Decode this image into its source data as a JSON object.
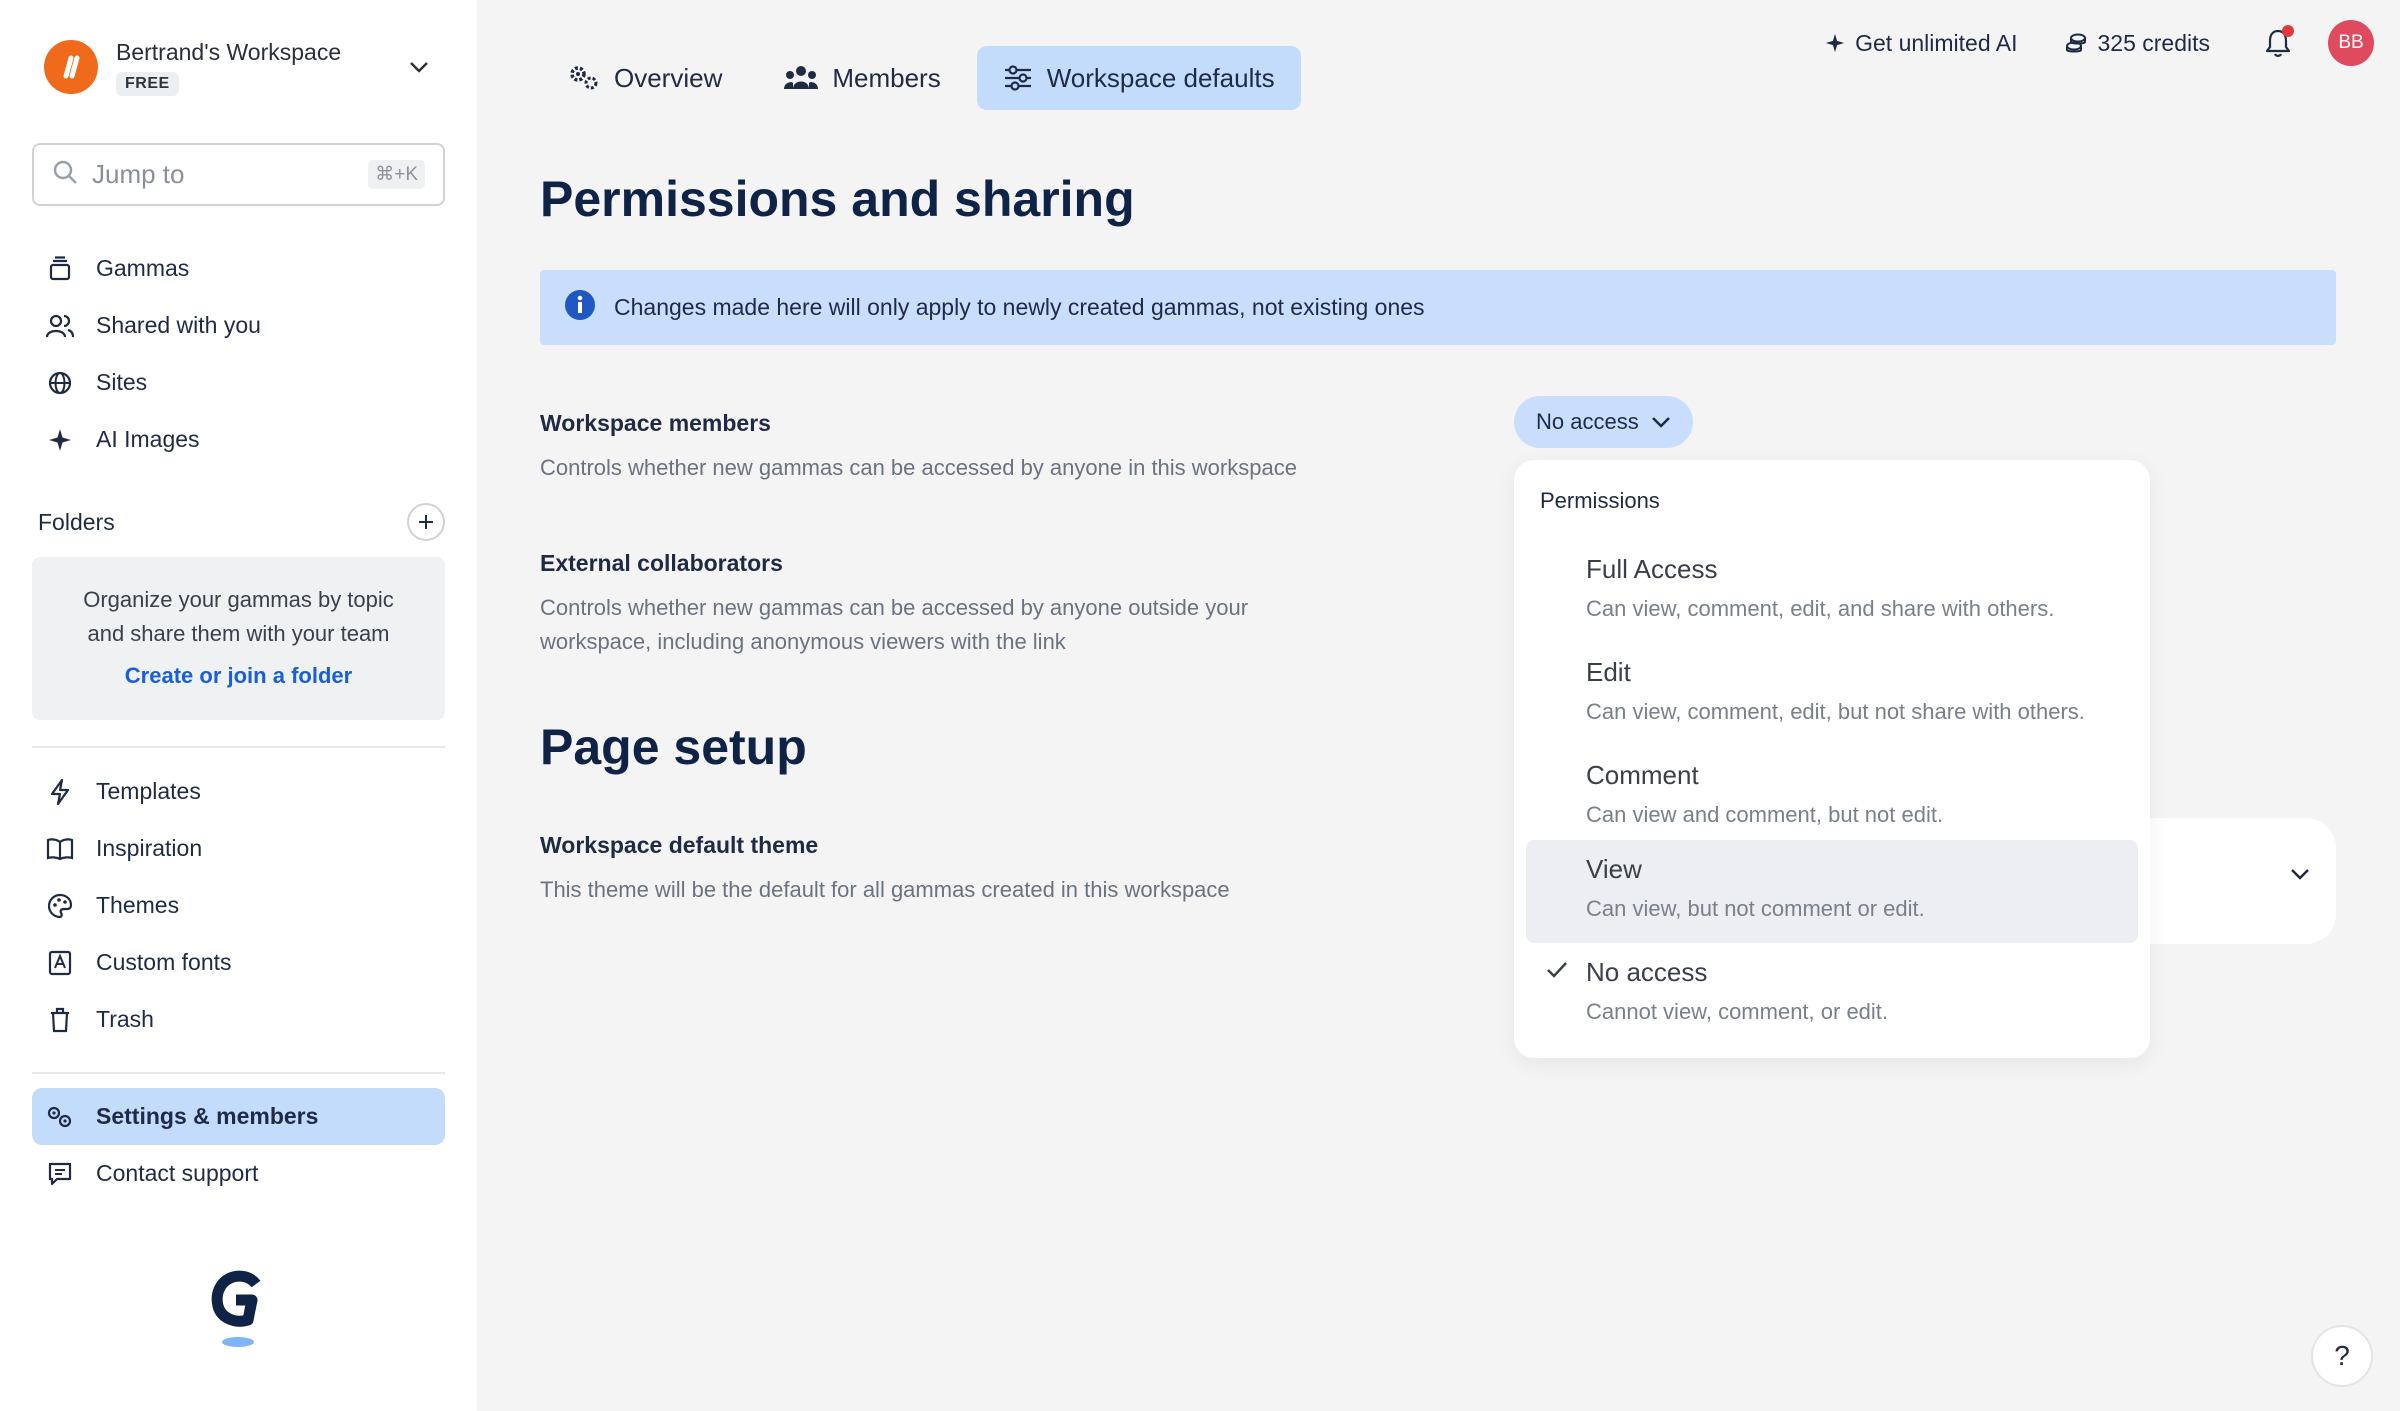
{
  "workspace": {
    "name": "Bertrand's Workspace",
    "plan": "FREE"
  },
  "search": {
    "placeholder": "Jump to",
    "shortcut": "⌘+K"
  },
  "nav_main": [
    {
      "label": "Gammas",
      "icon": "stack-icon"
    },
    {
      "label": "Shared with you",
      "icon": "users-icon"
    },
    {
      "label": "Sites",
      "icon": "globe-icon"
    },
    {
      "label": "AI Images",
      "icon": "sparkle-icon"
    }
  ],
  "folders": {
    "title": "Folders",
    "empty_line1": "Organize your gammas by topic",
    "empty_line2": "and share them with your team",
    "link": "Create or join a folder"
  },
  "nav_secondary": [
    {
      "label": "Templates",
      "icon": "bolt-icon"
    },
    {
      "label": "Inspiration",
      "icon": "book-icon"
    },
    {
      "label": "Themes",
      "icon": "palette-icon"
    },
    {
      "label": "Custom fonts",
      "icon": "font-icon"
    },
    {
      "label": "Trash",
      "icon": "trash-icon"
    }
  ],
  "nav_bottom": [
    {
      "label": "Settings & members",
      "icon": "gears-icon",
      "active": true
    },
    {
      "label": "Contact support",
      "icon": "chat-icon"
    }
  ],
  "tabs": [
    {
      "label": "Overview",
      "icon": "gears-icon"
    },
    {
      "label": "Members",
      "icon": "group-icon"
    },
    {
      "label": "Workspace defaults",
      "icon": "sliders-icon",
      "active": true
    }
  ],
  "topbar": {
    "ai_label": "Get unlimited AI",
    "credits": "325 credits",
    "avatar_initials": "BB"
  },
  "page": {
    "title": "Permissions and sharing",
    "banner": "Changes made here will only apply to newly created gammas, not existing ones",
    "workspace_members": {
      "title": "Workspace members",
      "desc": "Controls whether new gammas can be accessed by anyone in this workspace",
      "value": "No access"
    },
    "external": {
      "title": "External collaborators",
      "desc_line1": "Controls whether new gammas can be accessed by anyone outside your",
      "desc_line2": "workspace, including anonymous viewers with the link"
    },
    "page_setup_title": "Page setup",
    "default_theme": {
      "title": "Workspace default theme",
      "desc": "This theme will be the default for all gammas created in this workspace"
    }
  },
  "dropdown": {
    "title": "Permissions",
    "options": [
      {
        "label": "Full Access",
        "desc": "Can view, comment, edit, and share with others."
      },
      {
        "label": "Edit",
        "desc": "Can view, comment, edit, but not share with others."
      },
      {
        "label": "Comment",
        "desc": "Can view and comment, but not edit."
      },
      {
        "label": "View",
        "desc": "Can view, but not comment or edit.",
        "hovered": true
      },
      {
        "label": "No access",
        "desc": "Cannot view, comment, or edit.",
        "selected": true
      }
    ]
  },
  "help": {
    "label": "?"
  },
  "colors": {
    "accent_light": "#c3dcfc",
    "brand_orange": "#f06a1b",
    "link_blue": "#1a5fd6",
    "avatar": "#e04a5f"
  }
}
